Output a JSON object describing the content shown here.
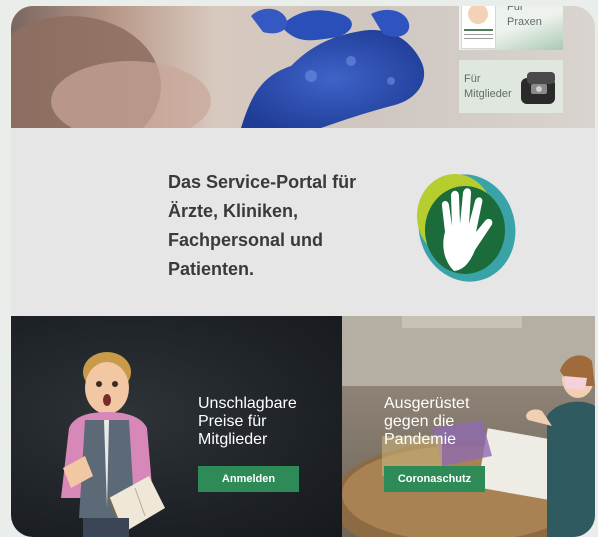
{
  "hero": {
    "tiles": [
      {
        "label_line1": "Für",
        "label_line2": "Praxen"
      },
      {
        "label_line1": "Für",
        "label_line2": "Mitglieder"
      }
    ]
  },
  "middle": {
    "headline": "Das Service-Portal für Ärzte, Kliniken, Fachpersonal und Patienten.",
    "logo_icon": "green-hand-logo-icon"
  },
  "promos": [
    {
      "title": "Unschlagbare Preise für Mitglieder",
      "button": "Anmelden"
    },
    {
      "title": "Ausgerüstet gegen die Pandemie",
      "button": "Coronaschutz"
    }
  ],
  "colors": {
    "accent_green": "#2e8b57",
    "background": "#e9eeea",
    "headline": "#3a3a3a"
  }
}
